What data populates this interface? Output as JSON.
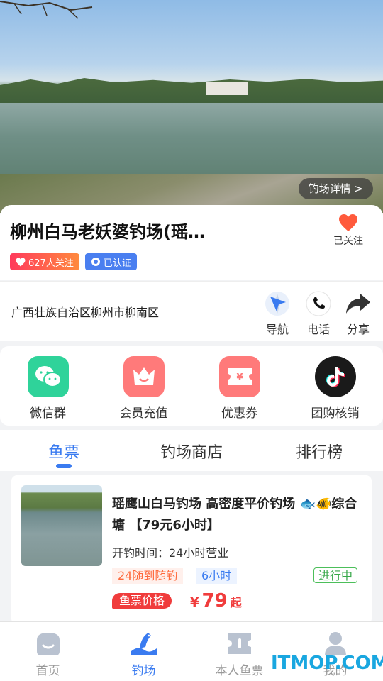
{
  "hero": {
    "detail_button": "钓场详情 >"
  },
  "venue": {
    "title": "柳州白马老妖婆钓场(瑶…",
    "follow_label": "已关注",
    "followers_badge": "627人关注",
    "certified_badge": "已认证"
  },
  "address": {
    "text": "广西壮族自治区柳州市柳南区",
    "actions": [
      {
        "label": "导航",
        "icon": "navigation-icon"
      },
      {
        "label": "电话",
        "icon": "phone-icon"
      },
      {
        "label": "分享",
        "icon": "share-icon"
      }
    ]
  },
  "features": [
    {
      "label": "微信群",
      "icon": "wechat-icon",
      "color": "#2fd39a"
    },
    {
      "label": "会员充值",
      "icon": "crown-icon",
      "color": "#ff7a7a"
    },
    {
      "label": "优惠券",
      "icon": "coupon-icon",
      "color": "#ff7a7a"
    },
    {
      "label": "团购核销",
      "icon": "tiktok-icon",
      "color": "#1a1a1a"
    }
  ],
  "tabs": [
    {
      "label": "鱼票",
      "active": true
    },
    {
      "label": "钓场商店",
      "active": false
    },
    {
      "label": "排行榜",
      "active": false
    }
  ],
  "ticket": {
    "name": "瑶鹰山白马钓场 高密度平价钓场 🐟🐠综合塘 【79元6小时】",
    "hours": "开钓时间：24小时营业",
    "tag1": "24随到随钓",
    "tag2": "6小时",
    "status": "进行中",
    "price_label": "鱼票价格",
    "currency": "¥",
    "price": "79",
    "price_suffix": "起"
  },
  "bottom_nav": [
    {
      "label": "首页",
      "icon": "home-icon",
      "active": false
    },
    {
      "label": "钓场",
      "icon": "fishing-spot-icon",
      "active": true
    },
    {
      "label": "本人鱼票",
      "icon": "ticket-icon",
      "active": false
    },
    {
      "label": "我的",
      "icon": "profile-icon",
      "active": false
    }
  ],
  "watermark": "ITMOP.COM",
  "colors": {
    "accent": "#3a7bf0",
    "price": "#f03c3c",
    "status": "#38a84a"
  }
}
